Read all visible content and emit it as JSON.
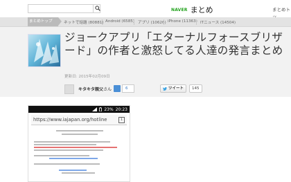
{
  "header": {
    "search_placeholder": "",
    "search_icon": "search-icon",
    "brand_naver": "NAVER",
    "brand_matome": "まとめ",
    "matome_link": "まとめトッ"
  },
  "categories": [
    {
      "label": "まとめトップ"
    },
    {
      "label": "ネットで話題 (80881)"
    },
    {
      "label": "Android (6585)"
    },
    {
      "label": "アプリ (10626)"
    },
    {
      "label": "iPhone (11363)"
    },
    {
      "label": "ITニュース (14504)"
    }
  ],
  "article": {
    "title": "ジョークアプリ「エターナルフォースブリザード」の作者と激怒してる人達の発言まとめ",
    "updated": "更新日: 2015年02月09日",
    "author": "キタキタ親父",
    "author_suffix": "さん",
    "favorite_count": "6",
    "tweet_label": "ツイート",
    "tweet_count": "145"
  },
  "embedded_screenshot": {
    "status_signal": "23%",
    "status_time": "20:23",
    "url": "https://www.iajapan.org/hotline",
    "tab_count": "1"
  },
  "colors": {
    "naver_green": "#1fa11a",
    "category_bar": "#e3e3e3",
    "hero_bg": "#f2f2f2",
    "favorite_blue": "#4a8fd6"
  }
}
